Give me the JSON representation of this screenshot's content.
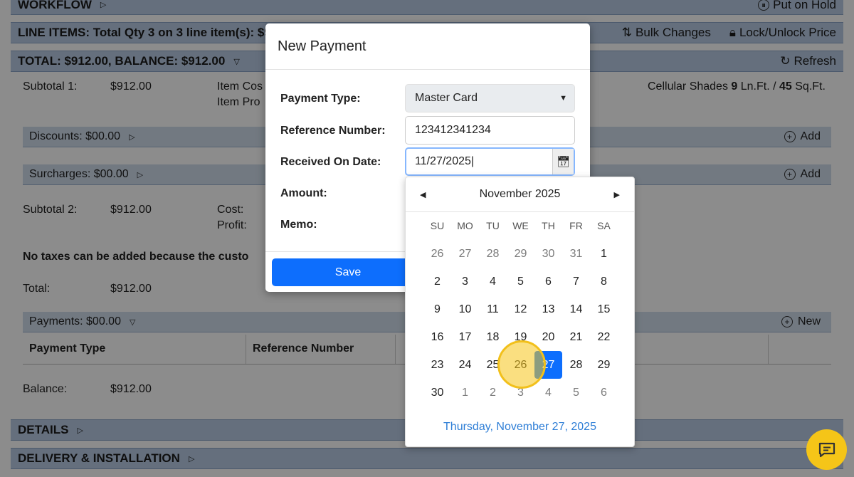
{
  "workflow": {
    "title": "WORKFLOW",
    "put_on_hold": "Put on Hold"
  },
  "line_items": {
    "title": "LINE ITEMS: Total Qty 3 on 3 line item(s): $9",
    "bulk_changes": "Bulk Changes",
    "lock_unlock": "Lock/Unlock Price"
  },
  "total_bar": {
    "title": "TOTAL: $912.00, BALANCE: $912.00",
    "refresh": "Refresh"
  },
  "summary": {
    "subtotal1_label": "Subtotal 1:",
    "subtotal1_value": "$912.00",
    "item_cost_label": "Item Cos",
    "item_profit_label": "Item Pro",
    "product_prefix": "Cellular Shades ",
    "product_lnft": "9",
    "product_lnft_unit": " Ln.Ft. / ",
    "product_sqft": "45",
    "product_sqft_unit": " Sq.Ft.",
    "discounts": "Discounts: $00.00",
    "surcharges": "Surcharges: $00.00",
    "add_label": "Add",
    "subtotal2_label": "Subtotal 2:",
    "subtotal2_value": "$912.00",
    "cost_label": "Cost:",
    "profit_label": "Profit:",
    "tax_notice": "No taxes can be added because the custo",
    "total_label": "Total:",
    "total_value": "$912.00",
    "payments": "Payments: $00.00",
    "new_label": "New",
    "col_payment_type": "Payment Type",
    "col_reference": "Reference Number",
    "balance_label": "Balance:",
    "balance_value": "$912.00",
    "details": "DETAILS",
    "delivery": "DELIVERY & INSTALLATION"
  },
  "modal": {
    "title": "New Payment",
    "payment_type_label": "Payment Type:",
    "payment_type_value": "Master Card",
    "reference_label": "Reference Number:",
    "reference_value": "123412341234",
    "received_label": "Received On Date:",
    "received_value": "11/27/2025",
    "amount_label": "Amount:",
    "memo_label": "Memo:",
    "save": "Save"
  },
  "calendar": {
    "month": "November 2025",
    "dow": [
      "SU",
      "MO",
      "TU",
      "WE",
      "TH",
      "FR",
      "SA"
    ],
    "weeks": [
      [
        [
          "26",
          1
        ],
        [
          "27",
          1
        ],
        [
          "28",
          1
        ],
        [
          "29",
          1
        ],
        [
          "30",
          1
        ],
        [
          "31",
          1
        ],
        [
          "1",
          0
        ]
      ],
      [
        [
          "2",
          0
        ],
        [
          "3",
          0
        ],
        [
          "4",
          0
        ],
        [
          "5",
          0
        ],
        [
          "6",
          0
        ],
        [
          "7",
          0
        ],
        [
          "8",
          0
        ]
      ],
      [
        [
          "9",
          0
        ],
        [
          "10",
          0
        ],
        [
          "11",
          0
        ],
        [
          "12",
          0
        ],
        [
          "13",
          0
        ],
        [
          "14",
          0
        ],
        [
          "15",
          0
        ]
      ],
      [
        [
          "16",
          0
        ],
        [
          "17",
          0
        ],
        [
          "18",
          0
        ],
        [
          "19",
          0
        ],
        [
          "20",
          0
        ],
        [
          "21",
          0
        ],
        [
          "22",
          0
        ]
      ],
      [
        [
          "23",
          0
        ],
        [
          "24",
          0
        ],
        [
          "25",
          0
        ],
        [
          "26",
          0
        ],
        [
          "27",
          2
        ],
        [
          "28",
          0
        ],
        [
          "29",
          0
        ]
      ],
      [
        [
          "30",
          0
        ],
        [
          "1",
          1
        ],
        [
          "2",
          1
        ],
        [
          "3",
          1
        ],
        [
          "4",
          1
        ],
        [
          "5",
          1
        ],
        [
          "6",
          1
        ]
      ]
    ],
    "footer": "Thursday, November 27, 2025"
  },
  "colors": {
    "primary": "#0d6efd",
    "header_bar": "#b8cbe3",
    "cursor": "#f5c518"
  }
}
